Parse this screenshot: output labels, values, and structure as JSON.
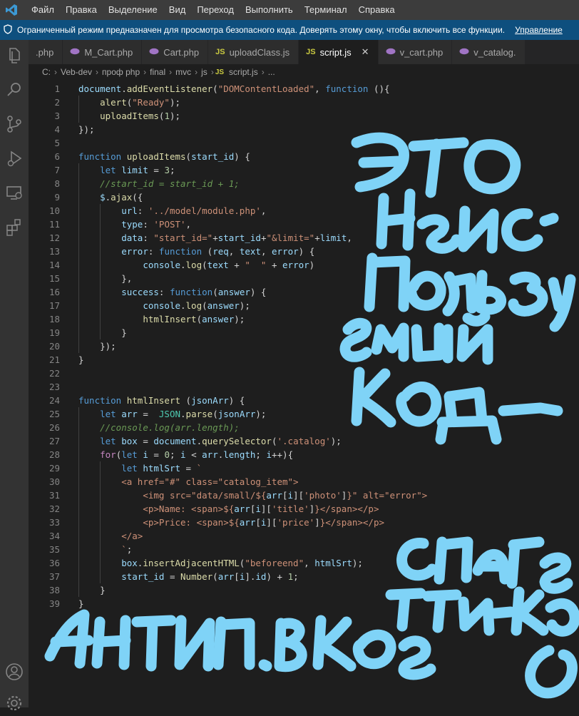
{
  "menu": {
    "items": [
      "Файл",
      "Правка",
      "Выделение",
      "Вид",
      "Переход",
      "Выполнить",
      "Терминал",
      "Справка"
    ]
  },
  "banner": {
    "text": "Ограниченный режим предназначен для просмотра безопасного кода. Доверять этому окну, чтобы включить все функции.",
    "link": "Управление"
  },
  "tabs": [
    {
      "label": ".php",
      "icon": "php-icon"
    },
    {
      "label": "M_Cart.php",
      "icon": "php-icon"
    },
    {
      "label": "Cart.php",
      "icon": "php-icon"
    },
    {
      "label": "uploadClass.js",
      "icon": "js-icon"
    },
    {
      "label": "script.js",
      "icon": "js-icon",
      "active": true
    },
    {
      "label": "v_cart.php",
      "icon": "php-icon"
    },
    {
      "label": "v_catalog.",
      "icon": "php-icon"
    }
  ],
  "tab_icons": {
    "php": "",
    "js": "JS",
    "close": "✕"
  },
  "breadcrumb": {
    "parts": [
      "C:",
      "Veb-dev",
      "проф php",
      "final",
      "mvc",
      "js"
    ],
    "file_badge": "JS",
    "file": "script.js",
    "tail": "..."
  },
  "code": {
    "lines": [
      [
        [
          "t-var",
          "document"
        ],
        [
          "t-pun",
          "."
        ],
        [
          "t-fn",
          "addEventListener"
        ],
        [
          "t-pun",
          "("
        ],
        [
          "t-str",
          "\"DOMContentLoaded\""
        ],
        [
          "t-pun",
          ", "
        ],
        [
          "t-kw",
          "function"
        ],
        [
          "t-pun",
          " (){"
        ]
      ],
      [
        [
          "t-pun",
          "    "
        ],
        [
          "t-fn",
          "alert"
        ],
        [
          "t-pun",
          "("
        ],
        [
          "t-str",
          "\"Ready\""
        ],
        [
          "t-pun",
          ");"
        ]
      ],
      [
        [
          "t-pun",
          "    "
        ],
        [
          "t-fn",
          "uploadItems"
        ],
        [
          "t-pun",
          "("
        ],
        [
          "t-num",
          "1"
        ],
        [
          "t-pun",
          ");"
        ]
      ],
      [
        [
          "t-pun",
          "});"
        ]
      ],
      [],
      [
        [
          "t-kw",
          "function "
        ],
        [
          "t-fn",
          "uploadItems"
        ],
        [
          "t-pun",
          "("
        ],
        [
          "t-var",
          "start_id"
        ],
        [
          "t-pun",
          ") {"
        ]
      ],
      [
        [
          "t-pun",
          "    "
        ],
        [
          "t-kw",
          "let "
        ],
        [
          "t-var",
          "limit"
        ],
        [
          "t-pun",
          " = "
        ],
        [
          "t-num",
          "3"
        ],
        [
          "t-pun",
          ";"
        ]
      ],
      [
        [
          "t-pun",
          "    "
        ],
        [
          "t-com",
          "//start_id = start_id + 1;"
        ]
      ],
      [
        [
          "t-pun",
          "    "
        ],
        [
          "t-var",
          "$"
        ],
        [
          "t-pun",
          "."
        ],
        [
          "t-fn",
          "ajax"
        ],
        [
          "t-pun",
          "({"
        ]
      ],
      [
        [
          "t-pun",
          "        "
        ],
        [
          "t-var",
          "url"
        ],
        [
          "t-pun",
          ": "
        ],
        [
          "t-str",
          "'../model/module.php'"
        ],
        [
          "t-pun",
          ","
        ]
      ],
      [
        [
          "t-pun",
          "        "
        ],
        [
          "t-var",
          "type"
        ],
        [
          "t-pun",
          ": "
        ],
        [
          "t-str",
          "'POST'"
        ],
        [
          "t-pun",
          ","
        ]
      ],
      [
        [
          "t-pun",
          "        "
        ],
        [
          "t-var",
          "data"
        ],
        [
          "t-pun",
          ": "
        ],
        [
          "t-str",
          "\"start_id=\""
        ],
        [
          "t-pun",
          "+"
        ],
        [
          "t-var",
          "start_id"
        ],
        [
          "t-pun",
          "+"
        ],
        [
          "t-str",
          "\"&limit=\""
        ],
        [
          "t-pun",
          "+"
        ],
        [
          "t-var",
          "limit"
        ],
        [
          "t-pun",
          ","
        ]
      ],
      [
        [
          "t-pun",
          "        "
        ],
        [
          "t-var",
          "error"
        ],
        [
          "t-pun",
          ": "
        ],
        [
          "t-kw",
          "function"
        ],
        [
          "t-pun",
          " ("
        ],
        [
          "t-var",
          "req"
        ],
        [
          "t-pun",
          ", "
        ],
        [
          "t-var",
          "text"
        ],
        [
          "t-pun",
          ", "
        ],
        [
          "t-var",
          "error"
        ],
        [
          "t-pun",
          ") {"
        ]
      ],
      [
        [
          "t-pun",
          "            "
        ],
        [
          "t-var",
          "console"
        ],
        [
          "t-pun",
          "."
        ],
        [
          "t-fn",
          "log"
        ],
        [
          "t-pun",
          "("
        ],
        [
          "t-var",
          "text"
        ],
        [
          "t-pun",
          " + "
        ],
        [
          "t-str",
          "\"  \""
        ],
        [
          "t-pun",
          " + "
        ],
        [
          "t-var",
          "error"
        ],
        [
          "t-pun",
          ")"
        ]
      ],
      [
        [
          "t-pun",
          "        },"
        ]
      ],
      [
        [
          "t-pun",
          "        "
        ],
        [
          "t-var",
          "success"
        ],
        [
          "t-pun",
          ": "
        ],
        [
          "t-kw",
          "function"
        ],
        [
          "t-pun",
          "("
        ],
        [
          "t-var",
          "answer"
        ],
        [
          "t-pun",
          ") {"
        ]
      ],
      [
        [
          "t-pun",
          "            "
        ],
        [
          "t-var",
          "console"
        ],
        [
          "t-pun",
          "."
        ],
        [
          "t-fn",
          "log"
        ],
        [
          "t-pun",
          "("
        ],
        [
          "t-var",
          "answer"
        ],
        [
          "t-pun",
          ");"
        ]
      ],
      [
        [
          "t-pun",
          "            "
        ],
        [
          "t-fn",
          "htmlInsert"
        ],
        [
          "t-pun",
          "("
        ],
        [
          "t-var",
          "answer"
        ],
        [
          "t-pun",
          ");"
        ]
      ],
      [
        [
          "t-pun",
          "        }"
        ]
      ],
      [
        [
          "t-pun",
          "    });"
        ]
      ],
      [
        [
          "t-pun",
          "}"
        ]
      ],
      [],
      [],
      [
        [
          "t-kw",
          "function "
        ],
        [
          "t-fn",
          "htmlInsert"
        ],
        [
          "t-pun",
          " ("
        ],
        [
          "t-var",
          "jsonArr"
        ],
        [
          "t-pun",
          ") {"
        ]
      ],
      [
        [
          "t-pun",
          "    "
        ],
        [
          "t-kw",
          "let "
        ],
        [
          "t-var",
          "arr"
        ],
        [
          "t-pun",
          " =  "
        ],
        [
          "t-cls",
          "JSON"
        ],
        [
          "t-pun",
          "."
        ],
        [
          "t-fn",
          "parse"
        ],
        [
          "t-pun",
          "("
        ],
        [
          "t-var",
          "jsonArr"
        ],
        [
          "t-pun",
          ");"
        ]
      ],
      [
        [
          "t-pun",
          "    "
        ],
        [
          "t-com",
          "//console.log(arr.length);"
        ]
      ],
      [
        [
          "t-pun",
          "    "
        ],
        [
          "t-kw",
          "let "
        ],
        [
          "t-var",
          "box"
        ],
        [
          "t-pun",
          " = "
        ],
        [
          "t-var",
          "document"
        ],
        [
          "t-pun",
          "."
        ],
        [
          "t-fn",
          "querySelector"
        ],
        [
          "t-pun",
          "("
        ],
        [
          "t-str",
          "'.catalog'"
        ],
        [
          "t-pun",
          ");"
        ]
      ],
      [
        [
          "t-pun",
          "    "
        ],
        [
          "t-ctl",
          "for"
        ],
        [
          "t-pun",
          "("
        ],
        [
          "t-kw",
          "let "
        ],
        [
          "t-var",
          "i"
        ],
        [
          "t-pun",
          " = "
        ],
        [
          "t-num",
          "0"
        ],
        [
          "t-pun",
          "; "
        ],
        [
          "t-var",
          "i"
        ],
        [
          "t-pun",
          " < "
        ],
        [
          "t-var",
          "arr"
        ],
        [
          "t-pun",
          "."
        ],
        [
          "t-var",
          "length"
        ],
        [
          "t-pun",
          "; "
        ],
        [
          "t-var",
          "i"
        ],
        [
          "t-pun",
          "++){"
        ]
      ],
      [
        [
          "t-pun",
          "        "
        ],
        [
          "t-kw",
          "let "
        ],
        [
          "t-var",
          "htmlSrt"
        ],
        [
          "t-pun",
          " = "
        ],
        [
          "t-str",
          "`"
        ]
      ],
      [
        [
          "t-pun",
          "        "
        ],
        [
          "t-str",
          "<a href=\"#\" class=\"catalog_item\">"
        ]
      ],
      [
        [
          "t-pun",
          "            "
        ],
        [
          "t-str",
          "<img src=\"data/small/${"
        ],
        [
          "t-var",
          "arr"
        ],
        [
          "t-pun",
          "["
        ],
        [
          "t-var",
          "i"
        ],
        [
          "t-pun",
          "]["
        ],
        [
          "t-str",
          "'photo'"
        ],
        [
          "t-pun",
          "]"
        ],
        [
          "t-str",
          "}\" alt=\"error\">"
        ]
      ],
      [
        [
          "t-pun",
          "            "
        ],
        [
          "t-str",
          "<p>Name: <span>${"
        ],
        [
          "t-var",
          "arr"
        ],
        [
          "t-pun",
          "["
        ],
        [
          "t-var",
          "i"
        ],
        [
          "t-pun",
          "]["
        ],
        [
          "t-str",
          "'title'"
        ],
        [
          "t-pun",
          "]"
        ],
        [
          "t-str",
          "}</span></p>"
        ]
      ],
      [
        [
          "t-pun",
          "            "
        ],
        [
          "t-str",
          "<p>Price: <span>${"
        ],
        [
          "t-var",
          "arr"
        ],
        [
          "t-pun",
          "["
        ],
        [
          "t-var",
          "i"
        ],
        [
          "t-pun",
          "]["
        ],
        [
          "t-str",
          "'price'"
        ],
        [
          "t-pun",
          "]"
        ],
        [
          "t-str",
          "}</span></p>"
        ]
      ],
      [
        [
          "t-pun",
          "        "
        ],
        [
          "t-str",
          "</a>"
        ]
      ],
      [
        [
          "t-pun",
          "        "
        ],
        [
          "t-str",
          "`"
        ],
        [
          "t-pun",
          ";"
        ]
      ],
      [
        [
          "t-pun",
          "        "
        ],
        [
          "t-var",
          "box"
        ],
        [
          "t-pun",
          "."
        ],
        [
          "t-fn",
          "insertAdjacentHTML"
        ],
        [
          "t-pun",
          "("
        ],
        [
          "t-str",
          "\"beforeend\""
        ],
        [
          "t-pun",
          ", "
        ],
        [
          "t-var",
          "htmlSrt"
        ],
        [
          "t-pun",
          ");"
        ]
      ],
      [
        [
          "t-pun",
          "        "
        ],
        [
          "t-var",
          "start_id"
        ],
        [
          "t-pun",
          " = "
        ],
        [
          "t-fn",
          "Number"
        ],
        [
          "t-pun",
          "("
        ],
        [
          "t-var",
          "arr"
        ],
        [
          "t-pun",
          "["
        ],
        [
          "t-var",
          "i"
        ],
        [
          "t-pun",
          "]."
        ],
        [
          "t-var",
          "id"
        ],
        [
          "t-pun",
          ") + "
        ],
        [
          "t-num",
          "1"
        ],
        [
          "t-pun",
          ";"
        ]
      ],
      [
        [
          "t-pun",
          "    }"
        ]
      ],
      [
        [
          "t-pun",
          "}"
        ]
      ]
    ]
  },
  "annotations": {
    "color": "#7fd3f7",
    "lines": [
      "ЭТО",
      "неис-",
      "пользу",
      "емый",
      "код-",
      "спаге",
      "тти-код",
      "Антип. в коде"
    ]
  }
}
